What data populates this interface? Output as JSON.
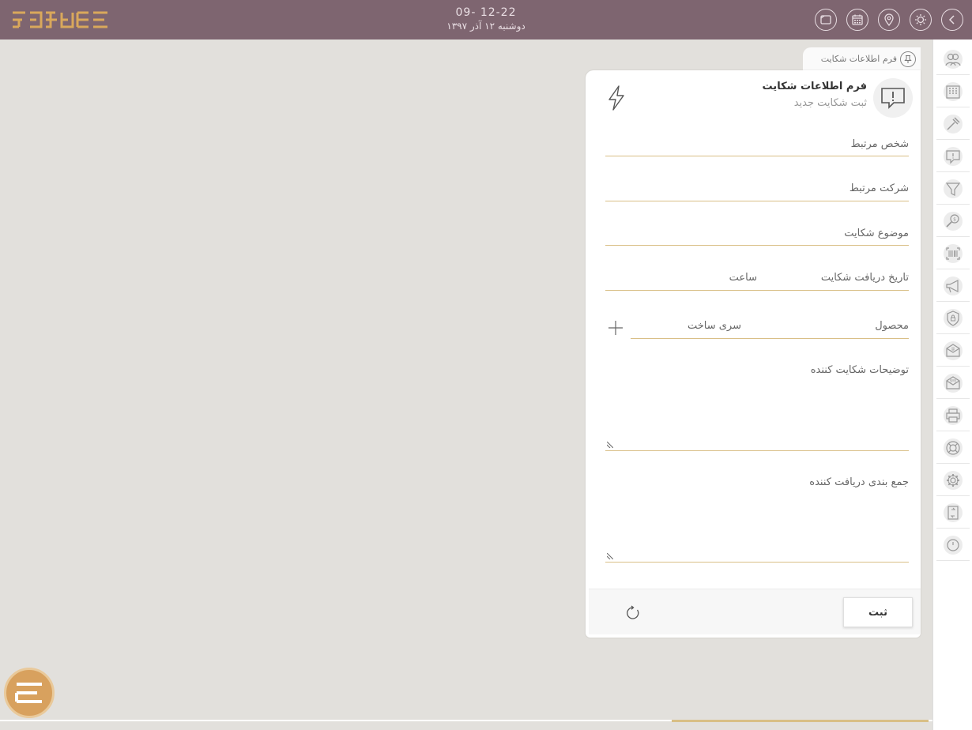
{
  "header": {
    "time": "09- 12-22",
    "date": "دوشنبه ۱۲ آذر ۱۳۹۷"
  },
  "top_buttons": [
    "back-icon",
    "brightness-icon",
    "location-icon",
    "calendar-icon",
    "card-icon"
  ],
  "sidebar": {
    "items": [
      "users-icon",
      "building-icon",
      "hammer-icon",
      "message-alert-icon",
      "filter-icon",
      "money-search-icon",
      "barcode-icon",
      "megaphone-icon",
      "shield-lock-icon",
      "email-icon",
      "sms-icon",
      "printer-icon",
      "lifebuoy-icon",
      "settings-icon",
      "transfer-icon",
      "power-icon"
    ]
  },
  "tab": {
    "label": "فرم اطلاعات شکایت"
  },
  "form": {
    "title": "فرم اطلاعات شکایت",
    "subtitle": "ثبت شکایت جدید",
    "fields": {
      "related_person": "شخص مرتبط",
      "related_company": "شرکت مرتبط",
      "complaint_subject": "موضوع شکایت",
      "receive_date": "تاریخ دریافت شکایت",
      "time": "ساعت",
      "product": "محصول",
      "serial": "سری ساخت",
      "complainant_description": "توضیحات شکایت کننده",
      "receiver_summary": "جمع بندی دریافت کننده"
    },
    "submit_label": "ثبت"
  },
  "colors": {
    "topbar": "#7e6570",
    "accent": "#d9bf86",
    "logo": "#d9a85b"
  }
}
